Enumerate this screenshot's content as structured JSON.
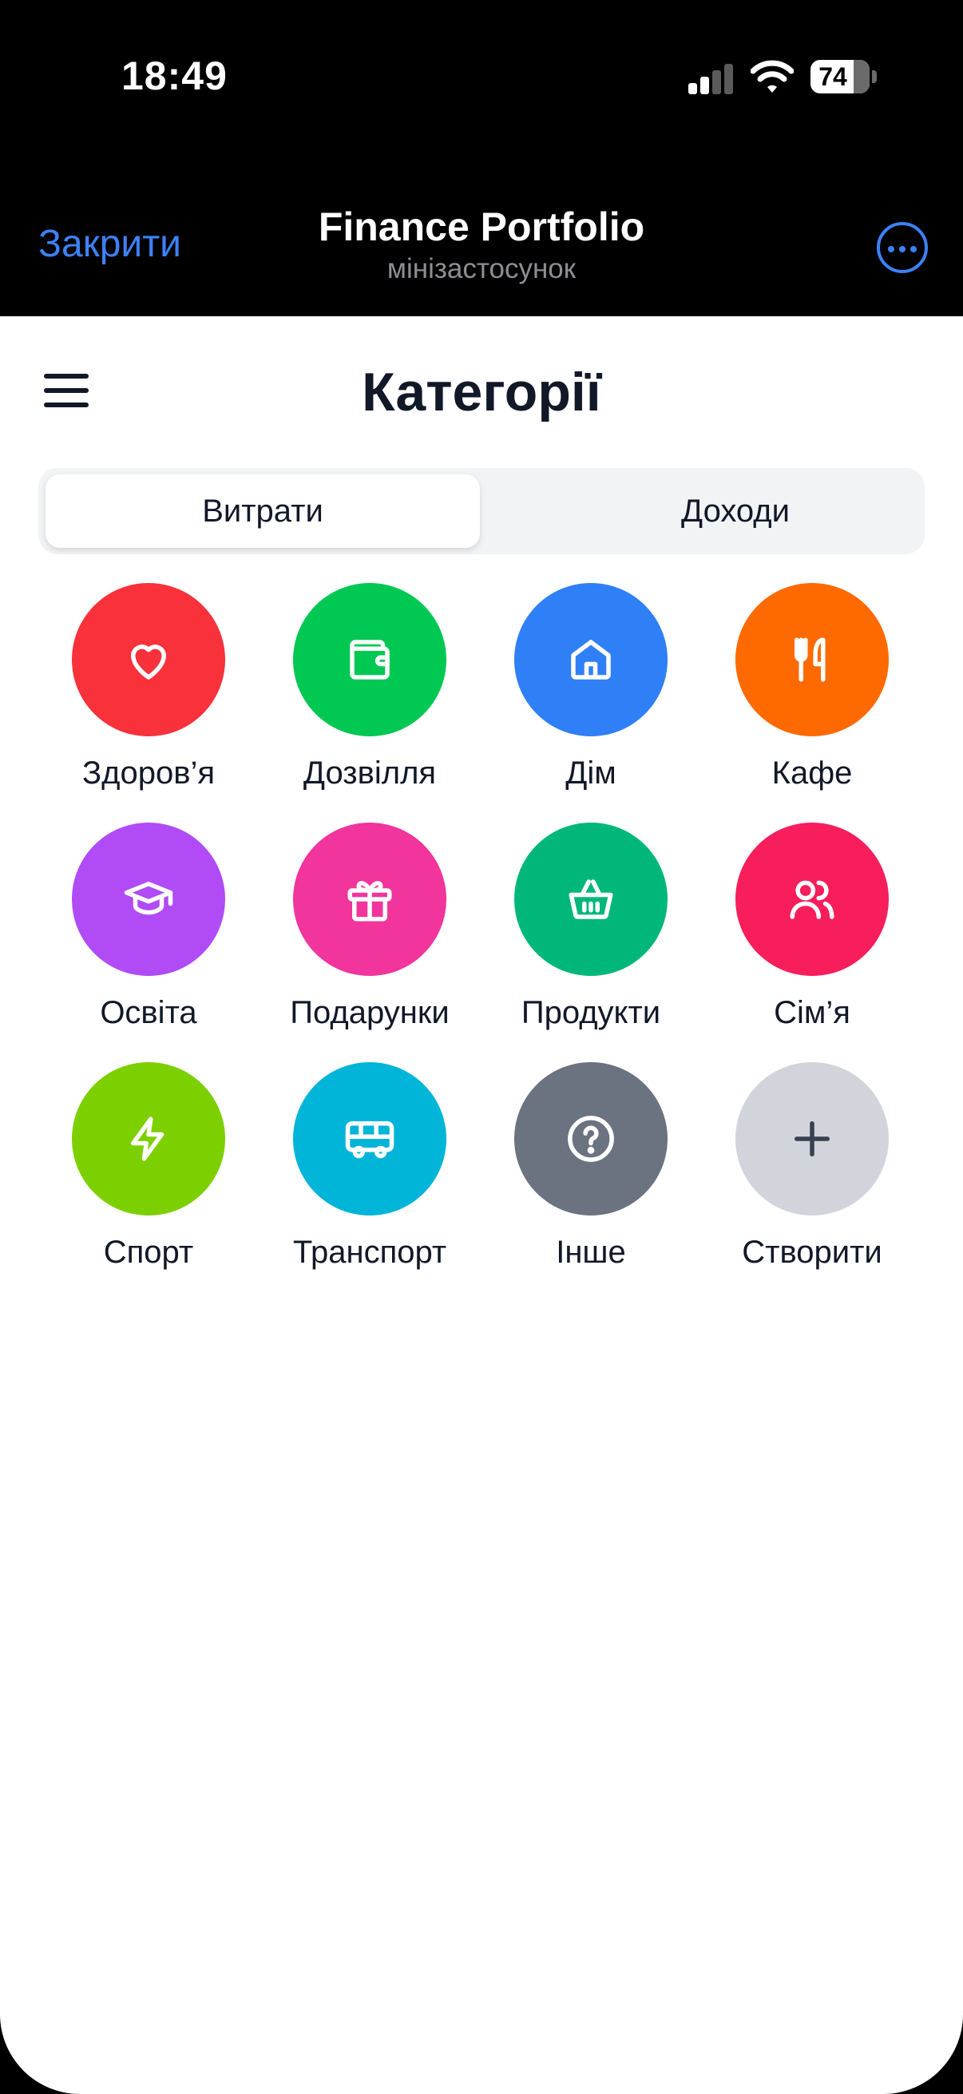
{
  "status_bar": {
    "time": "18:49",
    "battery": "74"
  },
  "mini_app": {
    "close_label": "Закрити",
    "title": "Finance Portfolio",
    "subtitle": "мінізастосунок",
    "accent_color": "#3b82f6"
  },
  "page": {
    "title": "Категорії",
    "tabs": [
      {
        "label": "Витрати",
        "active": true
      },
      {
        "label": "Доходи",
        "active": false
      }
    ]
  },
  "categories": [
    {
      "label": "Здоров’я",
      "icon": "heart-icon",
      "color": "#f9313a"
    },
    {
      "label": "Дозвілля",
      "icon": "wallet-icon",
      "color": "#00c853"
    },
    {
      "label": "Дім",
      "icon": "home-icon",
      "color": "#2f7ff7"
    },
    {
      "label": "Кафе",
      "icon": "utensils-icon",
      "color": "#ff6a00"
    },
    {
      "label": "Освіта",
      "icon": "graduation-cap-icon",
      "color": "#b04bf6"
    },
    {
      "label": "Подарунки",
      "icon": "gift-icon",
      "color": "#f2349d"
    },
    {
      "label": "Продукти",
      "icon": "basket-icon",
      "color": "#00b77a"
    },
    {
      "label": "Сім’я",
      "icon": "users-icon",
      "color": "#f81d5b"
    },
    {
      "label": "Спорт",
      "icon": "lightning-icon",
      "color": "#7dd000"
    },
    {
      "label": "Транспорт",
      "icon": "bus-icon",
      "color": "#00b5d8"
    },
    {
      "label": "Інше",
      "icon": "question-icon",
      "color": "#6b7280"
    },
    {
      "label": "Створити",
      "icon": "plus-icon",
      "color": "#d1d5db"
    }
  ]
}
